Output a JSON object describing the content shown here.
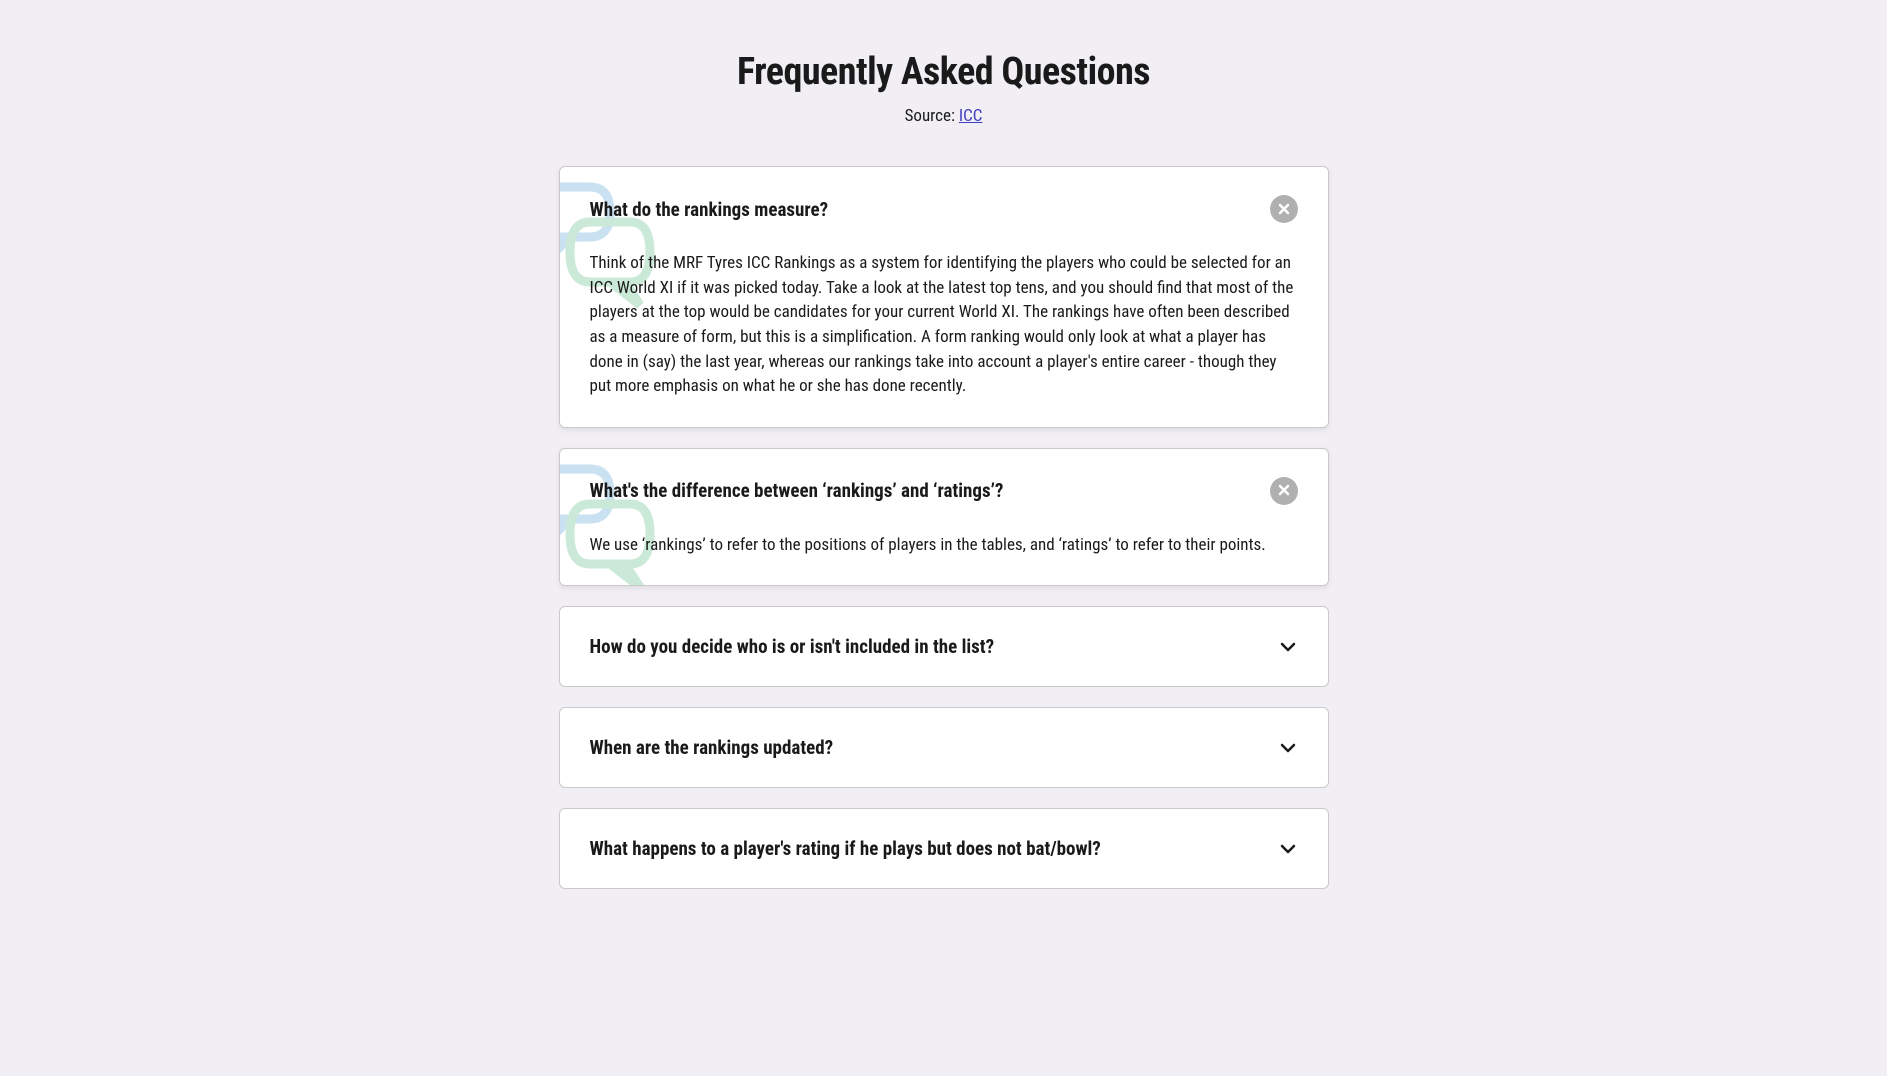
{
  "title": "Frequently Asked Questions",
  "source_prefix": "Source: ",
  "source_link_text": "ICC",
  "faq_items": [
    {
      "question": "What do the rankings measure?",
      "answer": "Think of the MRF Tyres ICC Rankings as a system for identifying the players who could be selected for an ICC World XI if it was picked today. Take a look at the latest top tens, and you should find that most of the players at the top would be candidates for your current World XI. The rankings have often been described as a measure of form, but this is a simplification. A form ranking would only look at what a player has done in (say) the last year, whereas our rankings take into account a player's entire career - though they put more emphasis on what he or she has done recently.",
      "expanded": true
    },
    {
      "question": "What's the difference between ‘rankings’ and ‘ratings’?",
      "answer": "We use ‘rankings’ to refer to the positions of players in the tables, and ‘ratings’ to refer to their points.",
      "expanded": true
    },
    {
      "question": "How do you decide who is or isn't included in the list?",
      "answer": "",
      "expanded": false
    },
    {
      "question": "When are the rankings updated?",
      "answer": "",
      "expanded": false
    },
    {
      "question": "What happens to a player's rating if he plays but does not bat/bowl?",
      "answer": "",
      "expanded": false
    }
  ]
}
